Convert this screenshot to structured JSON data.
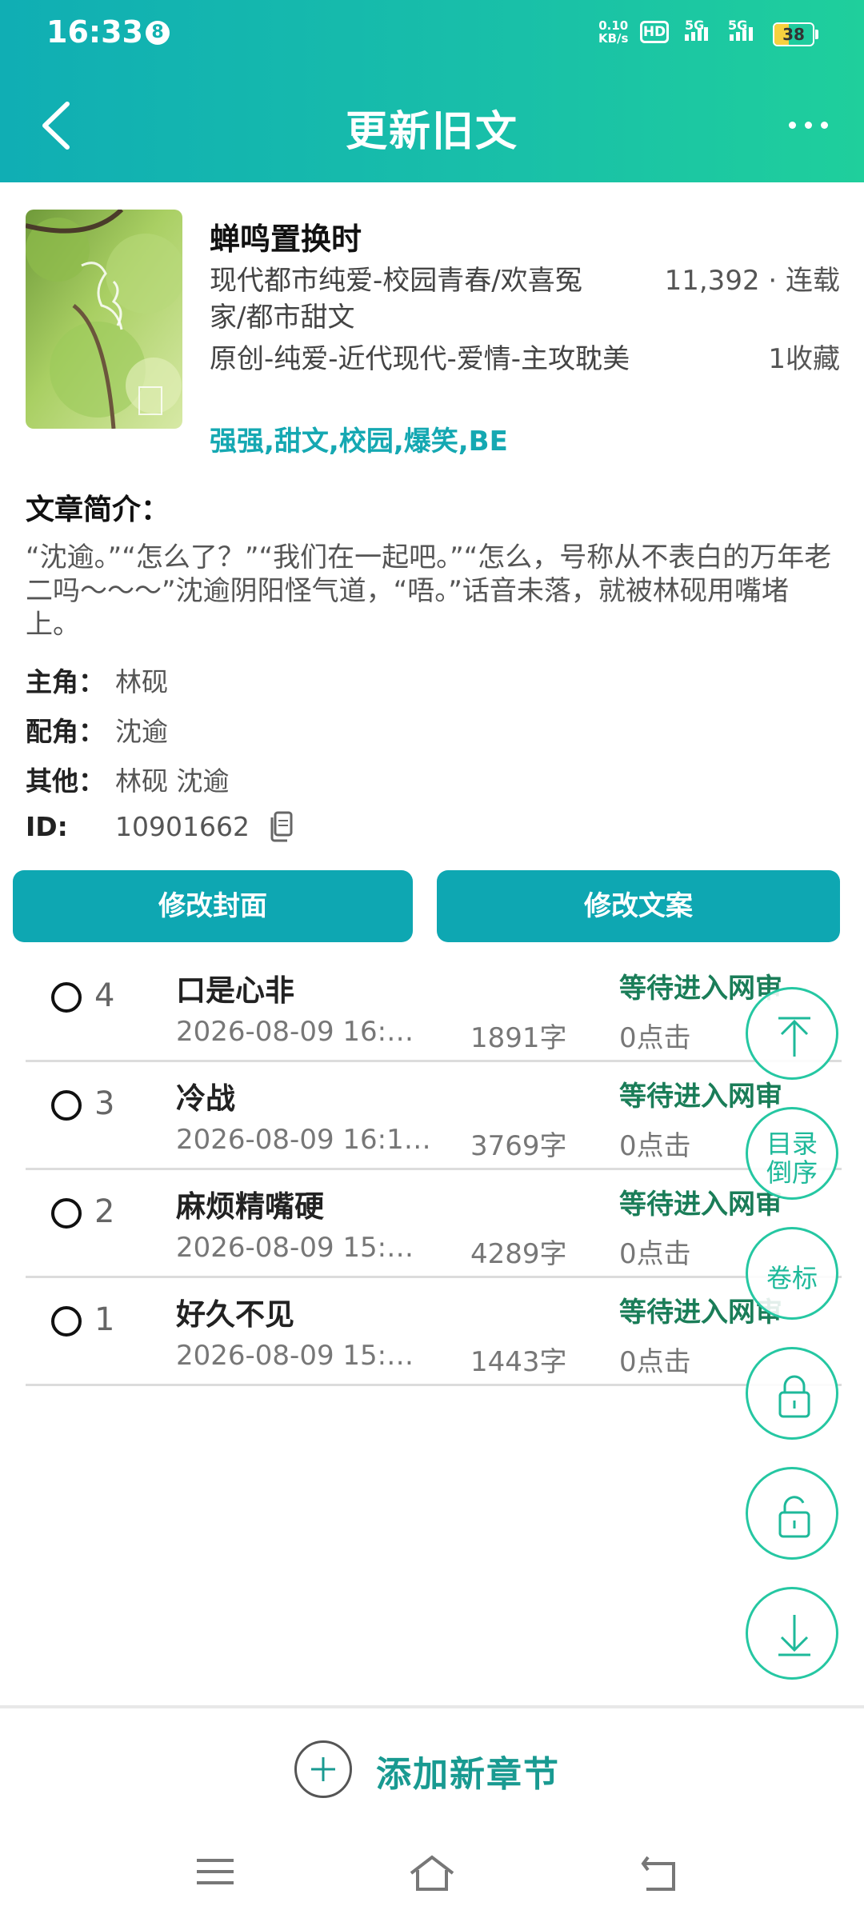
{
  "status_bar": {
    "time": "16:33",
    "notification_count": "8",
    "net_speed_value": "0.10",
    "net_speed_unit": "KB/s",
    "hd_label": "HD",
    "sim1_label": "5G",
    "sim2_label": "5G",
    "battery_level": "38"
  },
  "header": {
    "title": "更新旧文"
  },
  "book": {
    "title": "蝉鸣置换时",
    "genre": "现代都市纯爱-校园青春/欢喜冤家/都市甜文",
    "stat_words": "11,392 · 连载",
    "origin": "原创-纯爱-近代现代-爱情-主攻耽美",
    "stat_favorites": "1收藏",
    "tags": "强强,甜文,校园,爆笑,BE"
  },
  "intro": {
    "label": "文章简介：",
    "text": "“沈逾。”“怎么了？”“我们在一起吧。”“怎么，号称从不表白的万年老二吗～～～”沈逾阴阳怪气道，“唔。”话音未落，就被林砚用嘴堵上。"
  },
  "meta": {
    "protagonist_key": "主角：",
    "protagonist": "林砚",
    "supporting_key": "配角：",
    "supporting": "沈逾",
    "other_key": "其他：",
    "other": "林砚 沈逾",
    "id_key": "ID:",
    "id": "10901662"
  },
  "buttons": {
    "edit_cover": "修改封面",
    "edit_copy": "修改文案"
  },
  "chapters": [
    {
      "num": "4",
      "title": "口是心非",
      "date": "2026-08-09 16:…",
      "words": "1891字",
      "status": "等待进入网审",
      "clicks": "0点击"
    },
    {
      "num": "3",
      "title": "冷战",
      "date": "2026-08-09 16:1…",
      "words": "3769字",
      "status": "等待进入网审",
      "clicks": "0点击"
    },
    {
      "num": "2",
      "title": "麻烦精嘴硬",
      "date": "2026-08-09 15:…",
      "words": "4289字",
      "status": "等待进入网审",
      "clicks": "0点击"
    },
    {
      "num": "1",
      "title": "好久不见",
      "date": "2026-08-09 15:…",
      "words": "1443字",
      "status": "等待进入网审",
      "clicks": "0点击"
    }
  ],
  "fabs": {
    "reverse_line1": "目录",
    "reverse_line2": "倒序",
    "volume": "卷标"
  },
  "bottom": {
    "add_chapter": "添加新章节"
  },
  "colors": {
    "header_start": "#10aeb4",
    "header_end": "#1fcf9c",
    "button": "#0ea7b2",
    "tag": "#15a8b2",
    "status_green": "#1a7d58",
    "fab_border": "#25c7a2"
  },
  "icons": [
    "back-arrow-icon",
    "more-dots-icon",
    "copy-icon",
    "radio-icon",
    "arrow-top-icon",
    "lock-icon",
    "unlock-icon",
    "arrow-bottom-icon",
    "plus-icon",
    "menu-icon",
    "home-icon",
    "back-icon"
  ]
}
